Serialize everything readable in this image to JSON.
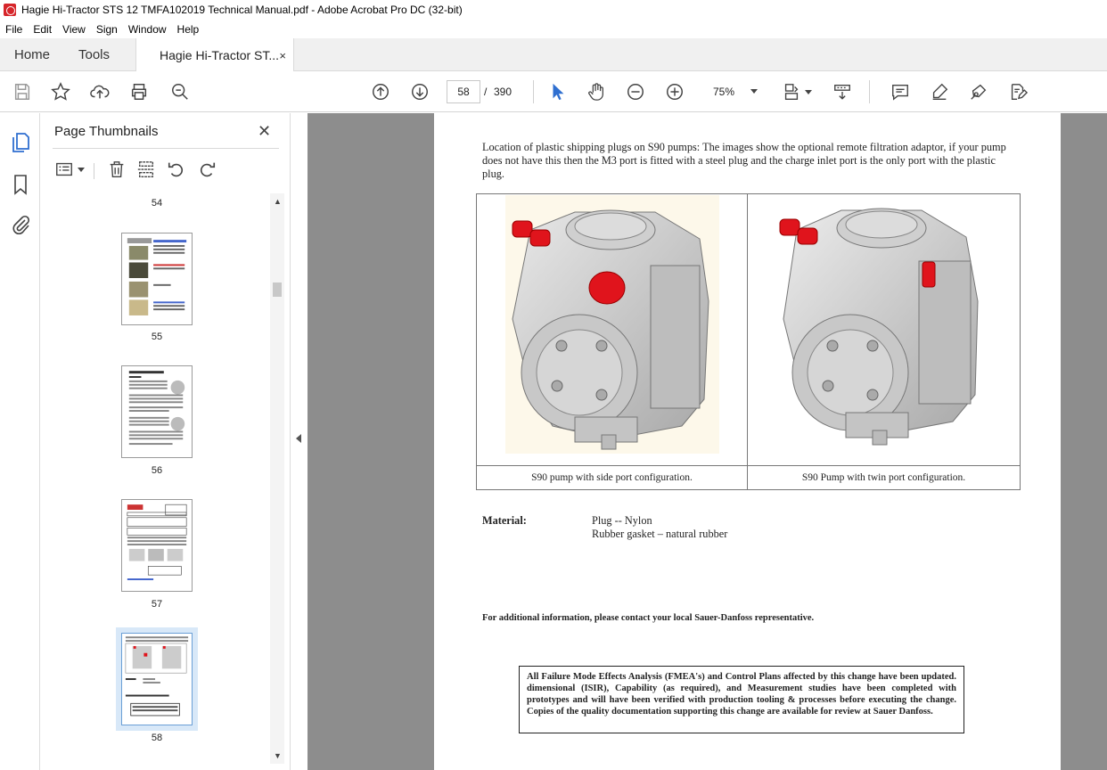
{
  "window": {
    "title": "Hagie Hi-Tractor STS 12 TMFA102019 Technical Manual.pdf - Adobe Acrobat Pro DC (32-bit)"
  },
  "menu": [
    "File",
    "Edit",
    "View",
    "Sign",
    "Window",
    "Help"
  ],
  "tabs": {
    "home": "Home",
    "tools": "Tools",
    "document": "Hagie Hi-Tractor ST...",
    "close": "×"
  },
  "toolbar": {
    "page_current": "58",
    "page_sep": "/",
    "page_total": "390",
    "zoom": "75%"
  },
  "sidepanel": {
    "title": "Page Thumbnails",
    "close": "✕",
    "thumbnails": [
      {
        "label": "54"
      },
      {
        "label": "55"
      },
      {
        "label": "56"
      },
      {
        "label": "57"
      },
      {
        "label": "58",
        "selected": true
      }
    ]
  },
  "document": {
    "intro": "Location of plastic shipping plugs on S90 pumps:  The images show the optional remote filtration adaptor, if your pump does not have this then the M3 port is fitted with a steel plug and the charge inlet port is the only port with the plastic plug.",
    "captions": [
      "S90 pump with side port configuration.",
      "S90 Pump with twin port configuration."
    ],
    "material_label": "Material:",
    "material_lines": [
      "Plug -- Nylon",
      "Rubber gasket – natural rubber"
    ],
    "contact": "For additional information, please contact your local Sauer-Danfoss representative.",
    "fmea": "All Failure Mode Effects Analysis (FMEA's) and Control Plans affected by this change have been updated. dimensional (ISIR), Capability (as required), and Measurement studies have been completed with prototypes and will have been verified with production tooling & processes before executing the change.  Copies of the quality documentation supporting this change are available for review at Sauer Danfoss."
  },
  "colors": {
    "accent": "#2f6fd0",
    "plug_red": "#e0141c",
    "viewer_bg": "#8d8d8d"
  }
}
